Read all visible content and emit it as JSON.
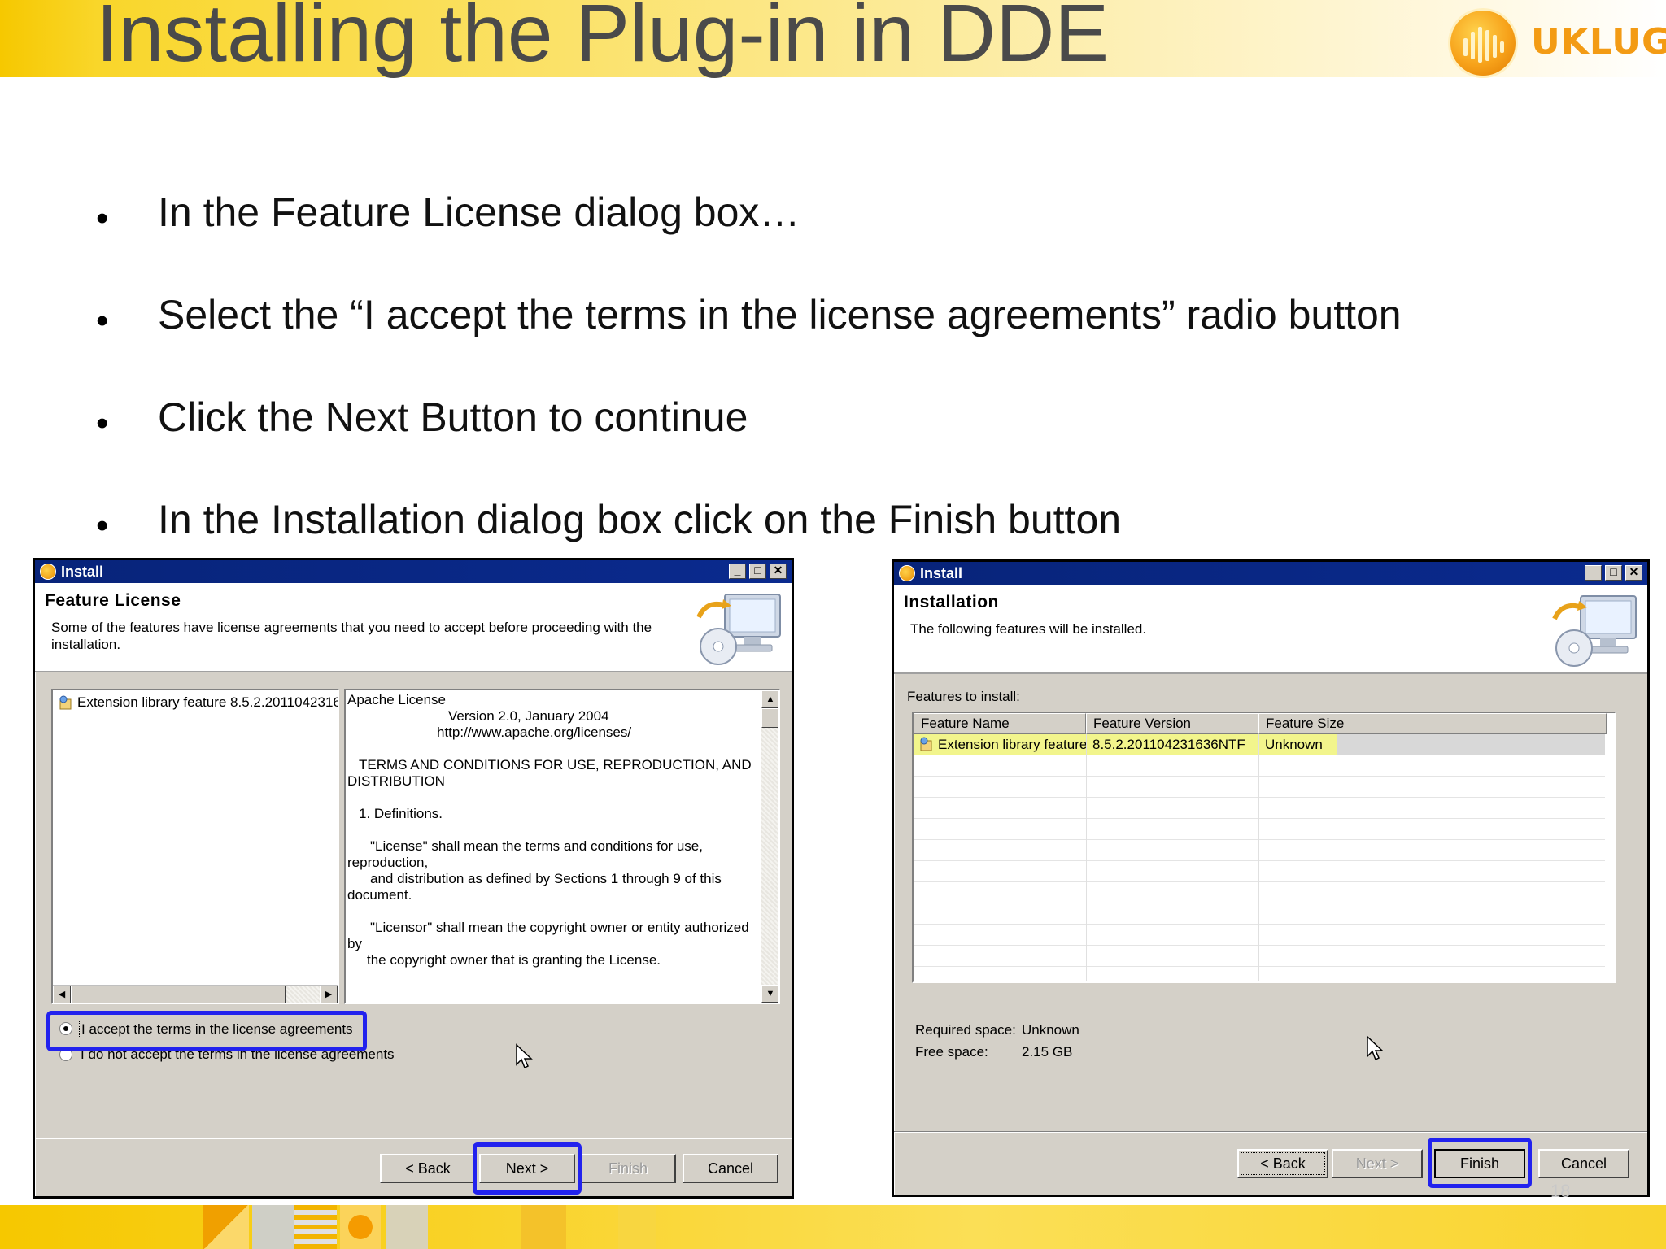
{
  "slide": {
    "title": "Installing the Plug-in in DDE",
    "logo_text": "UKLUG",
    "page_number": "18",
    "bullets": [
      "In the Feature License dialog box…",
      "Select the “I accept the terms in the license agreements” radio button",
      "Click the Next Button to continue",
      "In the Installation dialog box click on the Finish button"
    ]
  },
  "license_dialog": {
    "title": "Install",
    "heading": "Feature License",
    "description": "Some of the features have license agreements that you need to accept before proceeding with the installation.",
    "feature_item": "Extension library feature 8.5.2.2011042316",
    "license_lines": [
      "Apache License",
      "Version 2.0, January 2004",
      "http://www.apache.org/licenses/",
      "TERMS AND CONDITIONS FOR USE, REPRODUCTION, AND",
      "DISTRIBUTION",
      "1. Definitions.",
      "\"License\" shall mean the terms and conditions for use,",
      "reproduction,",
      "and distribution as defined by Sections 1 through 9 of this",
      "document.",
      "\"Licensor\" shall mean the copyright owner or entity authorized",
      "by",
      "the copyright owner that is granting the License."
    ],
    "accept_label": "I accept the terms in the license agreements",
    "decline_label": "I do not accept the terms in the license agreements",
    "accepted": true,
    "buttons": {
      "back": "< Back",
      "next": "Next >",
      "finish": "Finish",
      "cancel": "Cancel"
    }
  },
  "install_dialog": {
    "title": "Install",
    "heading": "Installation",
    "description": "The following features will be installed.",
    "features_label": "Features to install:",
    "columns": [
      "Feature Name",
      "Feature Version",
      "Feature Size"
    ],
    "rows": [
      {
        "name": "Extension library feature",
        "version": "8.5.2.201104231636NTF",
        "size": "Unknown"
      }
    ],
    "required_space_label": "Required space:",
    "required_space_value": "Unknown",
    "free_space_label": "Free space:",
    "free_space_value": "2.15 GB",
    "buttons": {
      "back": "< Back",
      "next": "Next >",
      "finish": "Finish",
      "cancel": "Cancel"
    }
  },
  "colors": {
    "accent_yellow": "#f6c800",
    "highlight_blue": "#2222ee",
    "titlebar_navy": "#08247a",
    "row_highlight": "#f2f58c"
  }
}
